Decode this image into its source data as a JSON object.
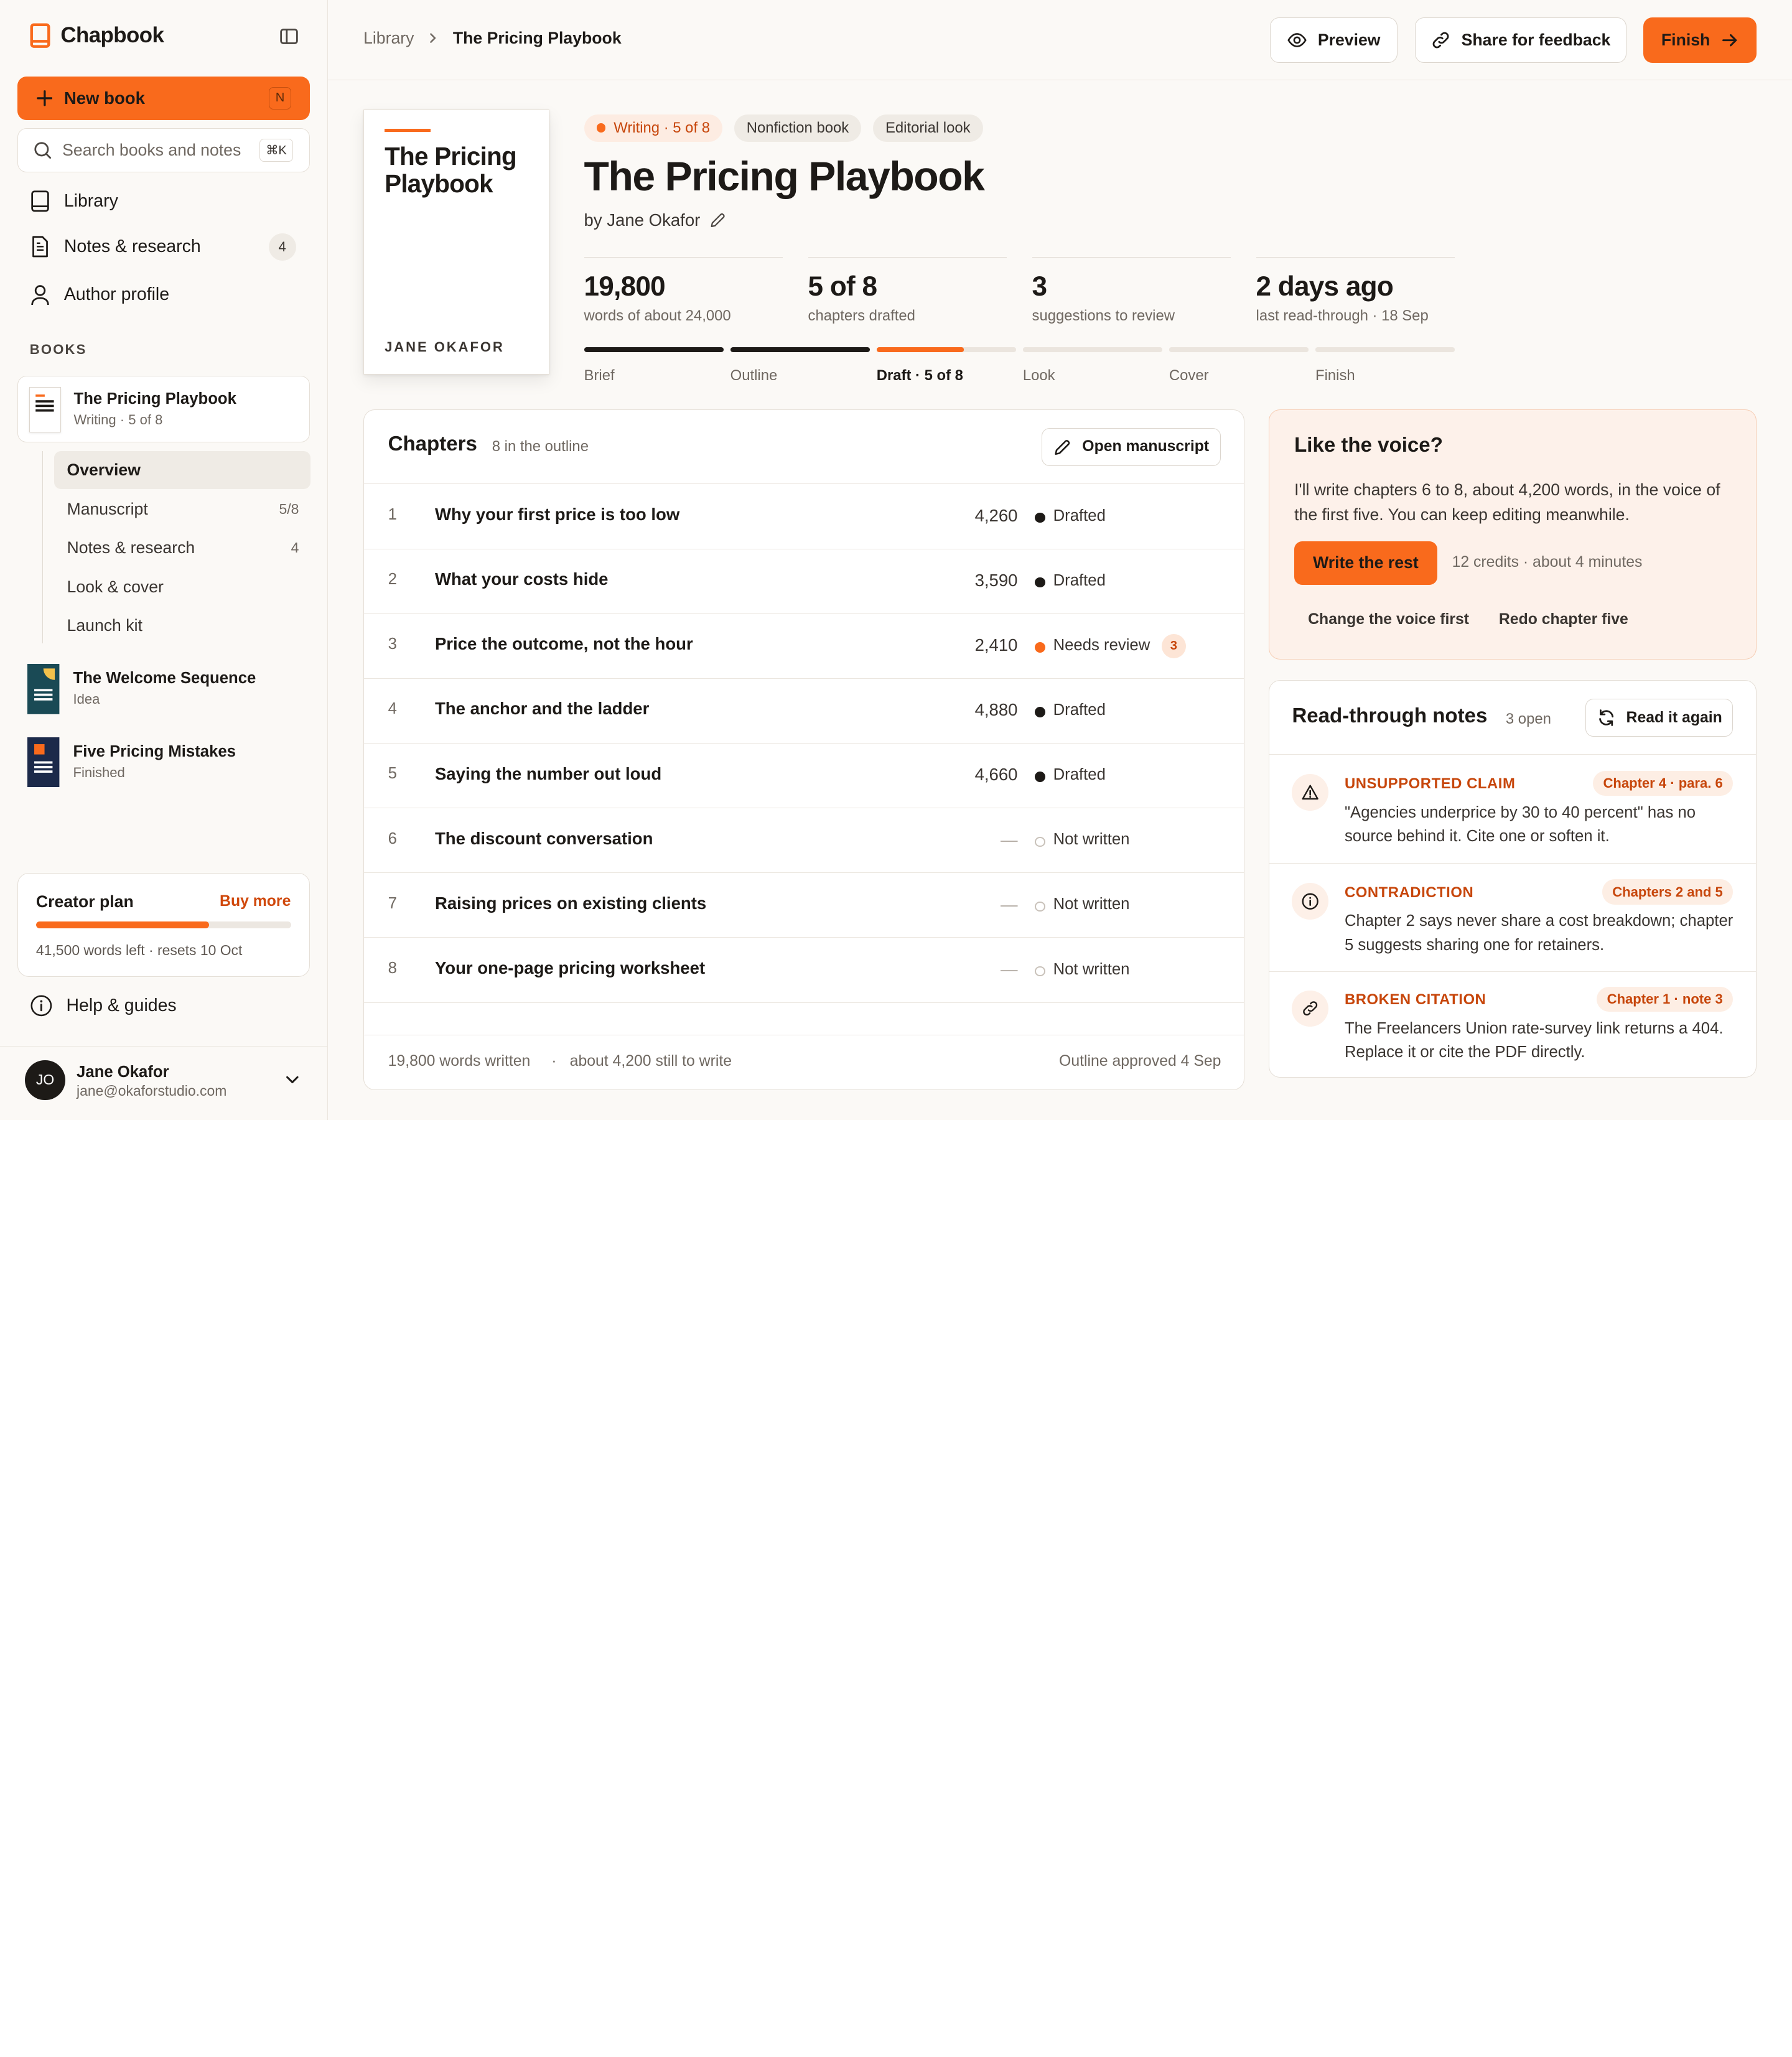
{
  "app": {
    "name": "Chapbook"
  },
  "sidebar": {
    "new_book": {
      "label": "New book",
      "shortcut": "N"
    },
    "search": {
      "placeholder": "Search books and notes",
      "shortcut": "⌘K"
    },
    "nav": [
      {
        "label": "Library",
        "icon": "book-icon"
      },
      {
        "label": "Notes & research",
        "icon": "document-icon",
        "count": "4"
      },
      {
        "label": "Author profile",
        "icon": "user-icon"
      }
    ],
    "books_label": "BOOKS",
    "current_book": {
      "title": "The Pricing Playbook",
      "status": "Writing · 5 of 8"
    },
    "subnav": [
      {
        "label": "Overview",
        "active": true
      },
      {
        "label": "Manuscript",
        "count": "5/8"
      },
      {
        "label": "Notes & research",
        "count": "4"
      },
      {
        "label": "Look & cover"
      },
      {
        "label": "Launch kit"
      }
    ],
    "other_books": [
      {
        "title": "The Welcome Sequence",
        "status": "Idea"
      },
      {
        "title": "Five Pricing Mistakes",
        "status": "Finished"
      }
    ],
    "plan": {
      "title": "Creator plan",
      "buy": "Buy more",
      "usage_fraction": 0.68,
      "detail": "41,500 words left · resets 10 Oct"
    },
    "help": "Help & guides",
    "user": {
      "initials": "JO",
      "name": "Jane Okafor",
      "email": "jane@okaforstudio.com"
    }
  },
  "topbar": {
    "breadcrumb": [
      "Library",
      "The Pricing Playbook"
    ],
    "preview": "Preview",
    "share": "Share for feedback",
    "finish": "Finish"
  },
  "book": {
    "cover_title": "The Pricing Playbook",
    "cover_author": "JANE OKAFOR",
    "chips": {
      "status": "Writing · 5 of 8",
      "type": "Nonfiction book",
      "look": "Editorial look"
    },
    "title": "The Pricing Playbook",
    "byline": "by Jane Okafor",
    "stats": [
      {
        "value": "19,800",
        "label": "words of about 24,000"
      },
      {
        "value": "5 of 8",
        "label": "chapters drafted"
      },
      {
        "value": "3",
        "label": "suggestions to review"
      },
      {
        "value": "2 days ago",
        "label": "last read-through · 18 Sep"
      }
    ],
    "stages": [
      {
        "label": "Brief",
        "progress": 1
      },
      {
        "label": "Outline",
        "progress": 1
      },
      {
        "label": "Draft · 5 of 8",
        "progress": 0.625,
        "current": true
      },
      {
        "label": "Look",
        "progress": 0
      },
      {
        "label": "Cover",
        "progress": 0
      },
      {
        "label": "Finish",
        "progress": 0
      }
    ]
  },
  "chapters": {
    "title": "Chapters",
    "count": "8 in the outline",
    "open": "Open manuscript",
    "rows": [
      {
        "n": "1",
        "title": "Why your first price is too low",
        "words": "4,260",
        "status": "Drafted",
        "state": "drafted"
      },
      {
        "n": "2",
        "title": "What your costs hide",
        "words": "3,590",
        "status": "Drafted",
        "state": "drafted"
      },
      {
        "n": "3",
        "title": "Price the outcome, not the hour",
        "words": "2,410",
        "status": "Needs review",
        "state": "review",
        "badge": "3"
      },
      {
        "n": "4",
        "title": "The anchor and the ladder",
        "words": "4,880",
        "status": "Drafted",
        "state": "drafted"
      },
      {
        "n": "5",
        "title": "Saying the number out loud",
        "words": "4,660",
        "status": "Drafted",
        "state": "drafted"
      },
      {
        "n": "6",
        "title": "The discount conversation",
        "words": "—",
        "status": "Not written",
        "state": "empty"
      },
      {
        "n": "7",
        "title": "Raising prices on existing clients",
        "words": "—",
        "status": "Not written",
        "state": "empty"
      },
      {
        "n": "8",
        "title": "Your one-page pricing worksheet",
        "words": "—",
        "status": "Not written",
        "state": "empty"
      }
    ],
    "footer": {
      "written": "19,800 words written",
      "sep": "·",
      "remaining": "about 4,200 still to write",
      "approved": "Outline approved 4 Sep"
    }
  },
  "voice": {
    "title": "Like the voice?",
    "body": "I'll write chapters 6 to 8, about 4,200 words, in the voice of the first five. You can keep editing meanwhile.",
    "action": "Write the rest",
    "cost": "12 credits · about 4 minutes",
    "alt1": "Change the voice first",
    "alt2": "Redo chapter five"
  },
  "notes": {
    "title": "Read-through notes",
    "count": "3 open",
    "again": "Read it again",
    "items": [
      {
        "kind": "UNSUPPORTED CLAIM",
        "ref": "Chapter 4 · para. 6",
        "text": "\"Agencies underprice by 30 to 40 percent\" has no source behind it. Cite one or soften it.",
        "icon": "warning-icon"
      },
      {
        "kind": "CONTRADICTION",
        "ref": "Chapters 2 and 5",
        "text": "Chapter 2 says never share a cost breakdown; chapter 5 suggests sharing one for retainers.",
        "icon": "info-icon"
      },
      {
        "kind": "BROKEN CITATION",
        "ref": "Chapter 1 · note 3",
        "text": "The Freelancers Union rate-survey link returns a 404. Replace it or cite the PDF directly.",
        "icon": "link-icon"
      }
    ]
  },
  "colors": {
    "accent": "#f96a1c",
    "accent_text": "#c7460b",
    "ink": "#1d1a17",
    "bg": "#fbf9f6"
  }
}
